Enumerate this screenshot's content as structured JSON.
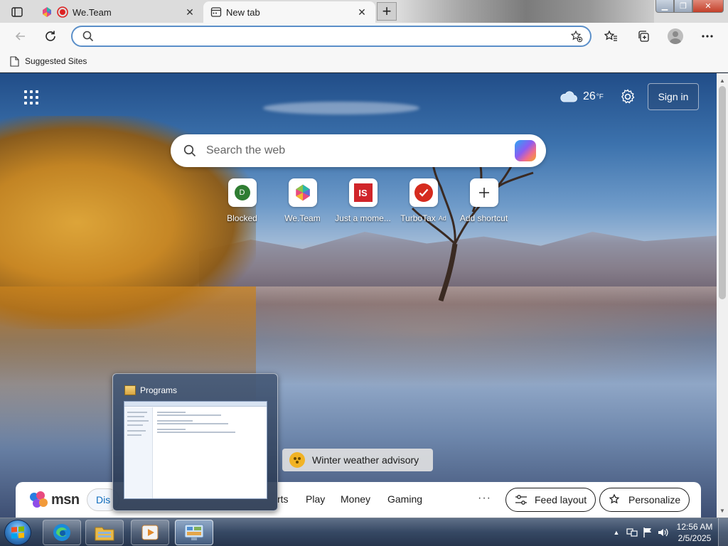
{
  "browser": {
    "tabs": [
      {
        "title": "We.Team",
        "active": false
      },
      {
        "title": "New tab",
        "active": true
      }
    ],
    "new_tab_symbol": "+",
    "close_symbol": "✕",
    "address_bar": {
      "value": "",
      "placeholder": ""
    },
    "favorites_bar": [
      {
        "label": "Suggested Sites"
      }
    ],
    "window_controls": {
      "minimize": "▁",
      "maximize": "❐",
      "close": "✕"
    }
  },
  "ntp": {
    "weather": {
      "temp": "26",
      "unit": "°F",
      "icon": "cloud-icon"
    },
    "signin_label": "Sign in",
    "search_placeholder": "Search the web",
    "shortcuts": [
      {
        "label": "Blocked",
        "badge": "D",
        "ad": ""
      },
      {
        "label": "We.Team",
        "badge": "",
        "ad": ""
      },
      {
        "label": "Just a mome...",
        "badge": "IS",
        "ad": ""
      },
      {
        "label": "TurboTax",
        "badge": "",
        "ad": "Ad"
      },
      {
        "label": "Add shortcut",
        "badge": "+",
        "ad": ""
      }
    ],
    "advisory": "Winter weather advisory",
    "msn": {
      "logo_text": "msn",
      "active_tab": "Dis",
      "tabs": [
        "rts",
        "Play",
        "Money",
        "Gaming"
      ],
      "more": "···",
      "feed_layout": "Feed layout",
      "personalize": "Personalize"
    }
  },
  "thumbnail_preview": {
    "title": "Programs"
  },
  "taskbar": {
    "apps": [
      "edge-icon",
      "file-explorer-icon",
      "media-player-icon",
      "control-panel-icon"
    ],
    "tray": {
      "time": "12:56 AM",
      "date": "2/5/2025",
      "overflow": "▲"
    }
  },
  "colors": {
    "accent": "#0f6cbd",
    "omnibox_border": "#5b8fc9",
    "close_button": "#c4402a"
  }
}
